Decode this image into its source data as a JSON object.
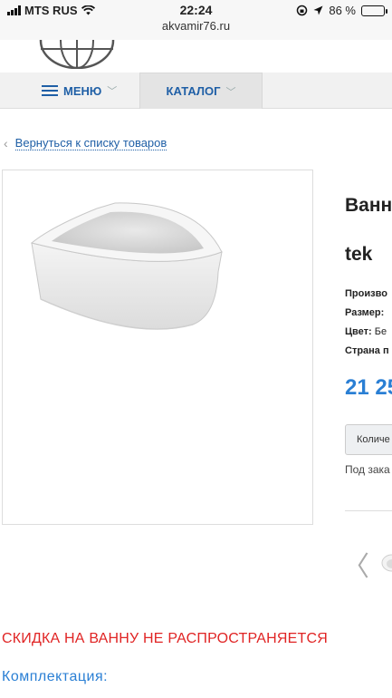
{
  "status_bar": {
    "carrier": "MTS RUS",
    "time": "22:24",
    "url": "akvamir76.ru",
    "battery": "86 %",
    "battery_level": 0.86
  },
  "nav": {
    "menu_label": "МЕНЮ",
    "catalog_label": "КАТАЛОГ"
  },
  "back_link": "Вернуться к списку товаров",
  "product": {
    "title": "Ванн\ntek",
    "specs": [
      {
        "label": "Произво",
        "value": ""
      },
      {
        "label": "Размер:",
        "value": ""
      },
      {
        "label": "Цвет:",
        "value": "Бе"
      },
      {
        "label": "Страна п",
        "value": ""
      }
    ],
    "price": "21 25",
    "quantity_button": "Количе",
    "order_note": "Под зака"
  },
  "notices": {
    "discount": "СКИДКА НА ВАННУ НЕ РАСПРОСТРАНЯЕТСЯ",
    "equipment_heading": "Комплектация:"
  },
  "colors": {
    "link_blue": "#1f5fa6",
    "price_blue": "#2a7fd4",
    "alert_red": "#e02424"
  }
}
